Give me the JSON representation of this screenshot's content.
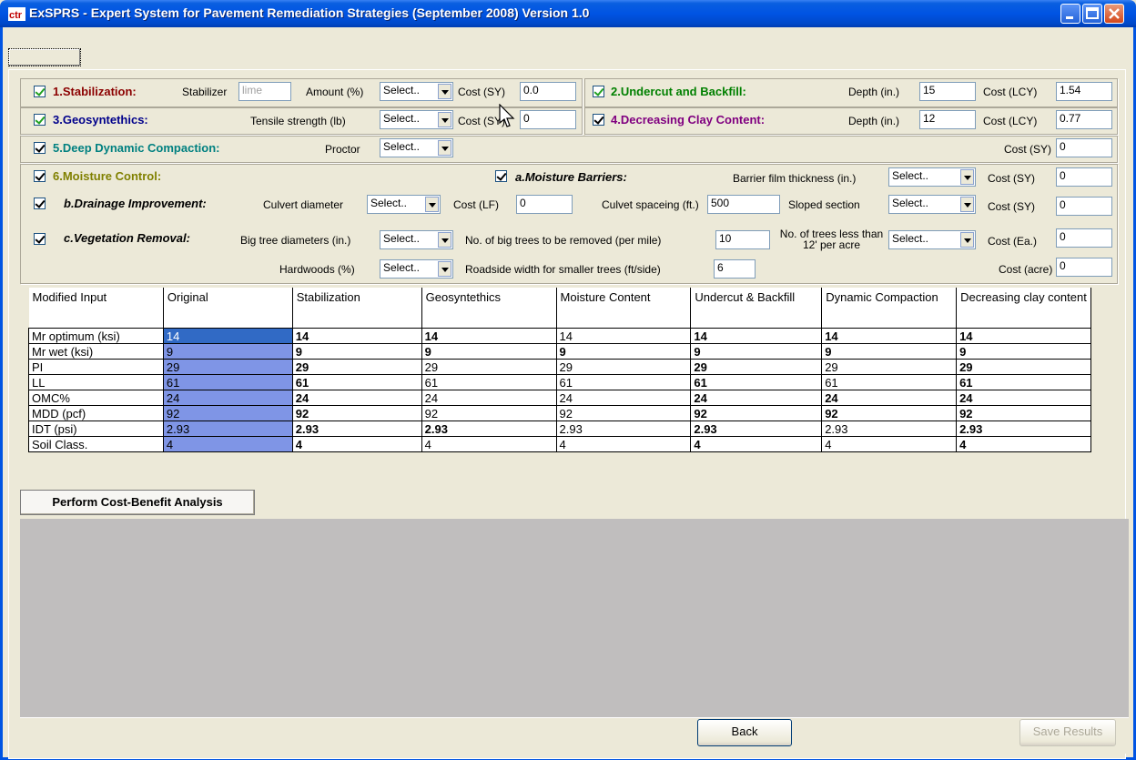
{
  "window": {
    "title": "ExSPRS - Expert System for Pavement Remediation Strategies (September 2008)  Version 1.0",
    "icon_text": "ctr"
  },
  "stabilization": {
    "label": "1.Stabilization:",
    "stabilizer_label": "Stabilizer",
    "stabilizer_value": "lime",
    "amount_label": "Amount (%)",
    "amount_value": "Select..",
    "cost_label": "Cost (SY)",
    "cost_value": "0.0"
  },
  "undercut": {
    "label": "2.Undercut and Backfill:",
    "depth_label": "Depth (in.)",
    "depth_value": "15",
    "cost_label": "Cost (LCY)",
    "cost_value": "1.54"
  },
  "geosynthetics": {
    "label": "3.Geosyntethics:",
    "tensile_label": "Tensile strength (lb)",
    "tensile_value": "Select..",
    "cost_label": "Cost (SY)",
    "cost_value": "0"
  },
  "clay": {
    "label": "4.Decreasing Clay Content:",
    "depth_label": "Depth (in.)",
    "depth_value": "12",
    "cost_label": "Cost (LCY)",
    "cost_value": "0.77"
  },
  "compaction": {
    "label": "5.Deep Dynamic Compaction:",
    "proctor_label": "Proctor",
    "proctor_value": "Select..",
    "cost_label": "Cost (SY)",
    "cost_value": "0"
  },
  "moisture": {
    "label": "6.Moisture Control:",
    "barriers_label": "a.Moisture Barriers:",
    "film_label": "Barrier film thickness (in.)",
    "film_value": "Select..",
    "cost_label": "Cost (SY)",
    "cost_value": "0"
  },
  "drainage": {
    "label": "b.Drainage Improvement:",
    "culvert_label": "Culvert diameter",
    "culvert_value": "Select..",
    "cost_lf_label": "Cost (LF)",
    "cost_lf_value": "0",
    "spacing_label": "Culvet spaceing (ft.)",
    "spacing_value": "500",
    "sloped_label": "Sloped section",
    "sloped_value": "Select..",
    "cost_sy_label": "Cost (SY)",
    "cost_sy_value": "0"
  },
  "vegetation": {
    "label": "c.Vegetation Removal:",
    "big_tree_label": "Big tree diameters (in.)",
    "big_tree_value": "Select..",
    "num_big_label": "No. of big trees to be removed (per mile)",
    "num_big_value": "10",
    "small_trees_label": "No. of trees less than 12' per acre",
    "small_trees_value": "Select..",
    "cost_ea_label": "Cost (Ea.)",
    "cost_ea_value": "0",
    "hardwoods_label": "Hardwoods (%)",
    "hardwoods_value": "Select..",
    "roadside_label": "Roadside width for smaller trees (ft/side)",
    "roadside_value": "6",
    "cost_acre_label": "Cost (acre)",
    "cost_acre_value": "0"
  },
  "grid": {
    "headers": [
      "Modified Input",
      "Original",
      "Stabilization",
      "Geosyntethics",
      "Moisture Content",
      "Undercut & Backfill",
      "Dynamic Compaction",
      "Decreasing clay content"
    ],
    "rows": [
      [
        "Mr optimum (ksi)",
        "14",
        "14",
        "14",
        "14",
        "14",
        "14",
        "14"
      ],
      [
        "Mr wet (ksi)",
        "9",
        "9",
        "9",
        "9",
        "9",
        "9",
        "9"
      ],
      [
        "PI",
        "29",
        "29",
        "29",
        "29",
        "29",
        "29",
        "29"
      ],
      [
        "LL",
        "61",
        "61",
        "61",
        "61",
        "61",
        "61",
        "61"
      ],
      [
        "OMC%",
        "24",
        "24",
        "24",
        "24",
        "24",
        "24",
        "24"
      ],
      [
        "MDD (pcf)",
        "92",
        "92",
        "92",
        "92",
        "92",
        "92",
        "92"
      ],
      [
        "IDT (psi)",
        "2.93",
        "2.93",
        "2.93",
        "2.93",
        "2.93",
        "2.93",
        "2.93"
      ],
      [
        "Soil Class.",
        "4",
        "4",
        "4",
        "4",
        "4",
        "4",
        "4"
      ]
    ]
  },
  "buttons": {
    "cba": "Perform Cost-Benefit Analysis",
    "back": "Back",
    "save": "Save Results"
  },
  "colors": {
    "stabilization": "#8b0000",
    "undercut": "#008000",
    "geosynthetics": "#00008b",
    "clay": "#800080",
    "compaction": "#008080",
    "moisture": "#808000"
  }
}
